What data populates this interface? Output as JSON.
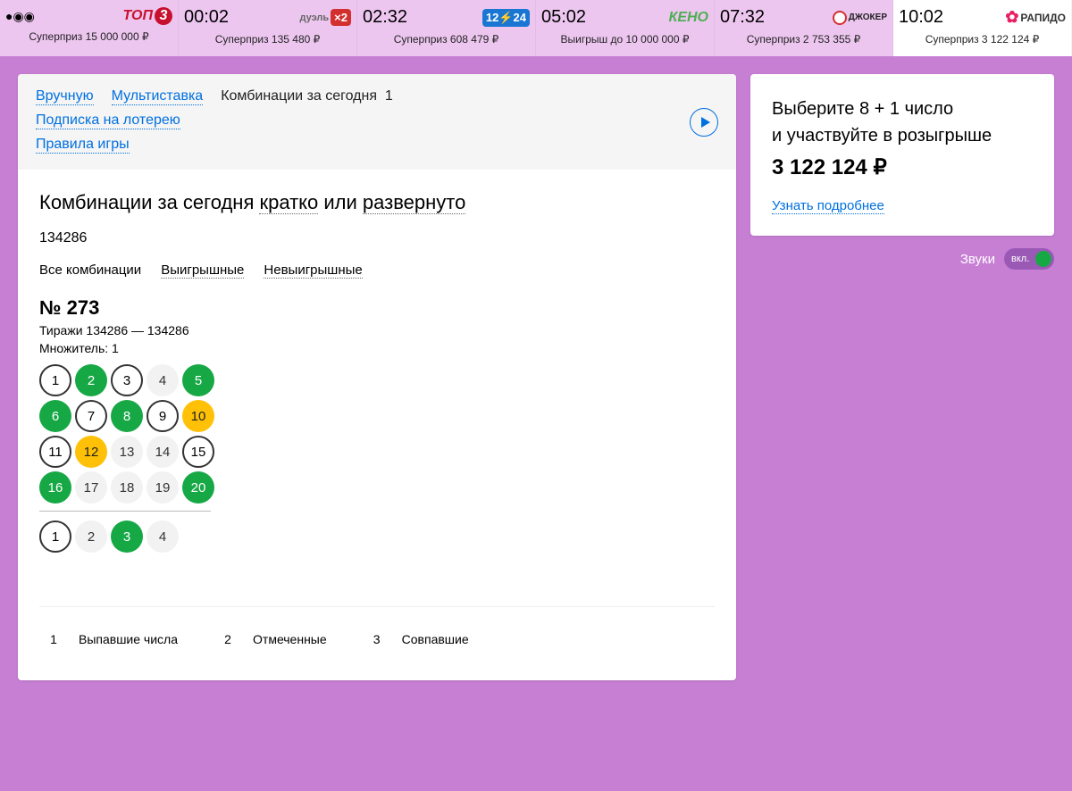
{
  "games": [
    {
      "time": "00:02",
      "logo": "top3",
      "sub": "Суперприз 15 000 000 ₽"
    },
    {
      "time": "02:32",
      "logo": "duel",
      "sub": "Суперприз 135 480 ₽"
    },
    {
      "time": "05:02",
      "logo": "1224",
      "sub": "Суперприз 608 479 ₽"
    },
    {
      "time": "07:32",
      "logo": "keno",
      "sub": "Выигрыш до 10 000 000 ₽"
    },
    {
      "time": "10:02",
      "logo": "joker",
      "sub": "Суперприз 2 753 355 ₽"
    },
    {
      "time": "",
      "logo": "rapido",
      "sub": "Суперприз 3 122 124 ₽",
      "active": true,
      "timeAlt": "10:02"
    }
  ],
  "tabs": {
    "manual": "Вручную",
    "multi": "Мультиставка",
    "today": "Комбинации за сегодня",
    "todayCount": "1",
    "subscribe": "Подписка на лотерею",
    "rules": "Правила игры"
  },
  "section": {
    "title_prefix": "Комбинации за сегодня ",
    "brief": "кратко",
    "or": " или ",
    "expanded": "развернуто"
  },
  "drawId": "134286",
  "filters": {
    "all": "Все комбинации",
    "win": "Выигрышные",
    "lose": "Невыигрышные"
  },
  "ticket": {
    "num": "№ 273",
    "range": "Тиражи 134286 — 134286",
    "mult": "Множитель: 1"
  },
  "main_grid": [
    {
      "n": 1,
      "s": "drawn"
    },
    {
      "n": 2,
      "s": "marked"
    },
    {
      "n": 3,
      "s": "drawn"
    },
    {
      "n": 4,
      "s": "plain"
    },
    {
      "n": 5,
      "s": "marked"
    },
    {
      "n": 6,
      "s": "marked"
    },
    {
      "n": 7,
      "s": "drawn"
    },
    {
      "n": 8,
      "s": "marked"
    },
    {
      "n": 9,
      "s": "drawn"
    },
    {
      "n": 10,
      "s": "matched"
    },
    {
      "n": 11,
      "s": "drawn"
    },
    {
      "n": 12,
      "s": "matched"
    },
    {
      "n": 13,
      "s": "plain"
    },
    {
      "n": 14,
      "s": "plain"
    },
    {
      "n": 15,
      "s": "drawn"
    },
    {
      "n": 16,
      "s": "marked"
    },
    {
      "n": 17,
      "s": "plain"
    },
    {
      "n": 18,
      "s": "plain"
    },
    {
      "n": 19,
      "s": "plain"
    },
    {
      "n": 20,
      "s": "marked"
    }
  ],
  "bonus_grid": [
    {
      "n": 1,
      "s": "drawn"
    },
    {
      "n": 2,
      "s": "plain"
    },
    {
      "n": 3,
      "s": "marked"
    },
    {
      "n": 4,
      "s": "plain"
    }
  ],
  "legend": {
    "drawn": "Выпавшие числа",
    "marked": "Отмеченные",
    "matched": "Совпавшие"
  },
  "promo": {
    "line1": "Выберите 8 + 1 число",
    "line2": "и участвуйте в розыгрыше",
    "prize": "3 122 124 ₽",
    "link": "Узнать подробнее"
  },
  "sound": {
    "label": "Звуки",
    "state": "вкл."
  }
}
